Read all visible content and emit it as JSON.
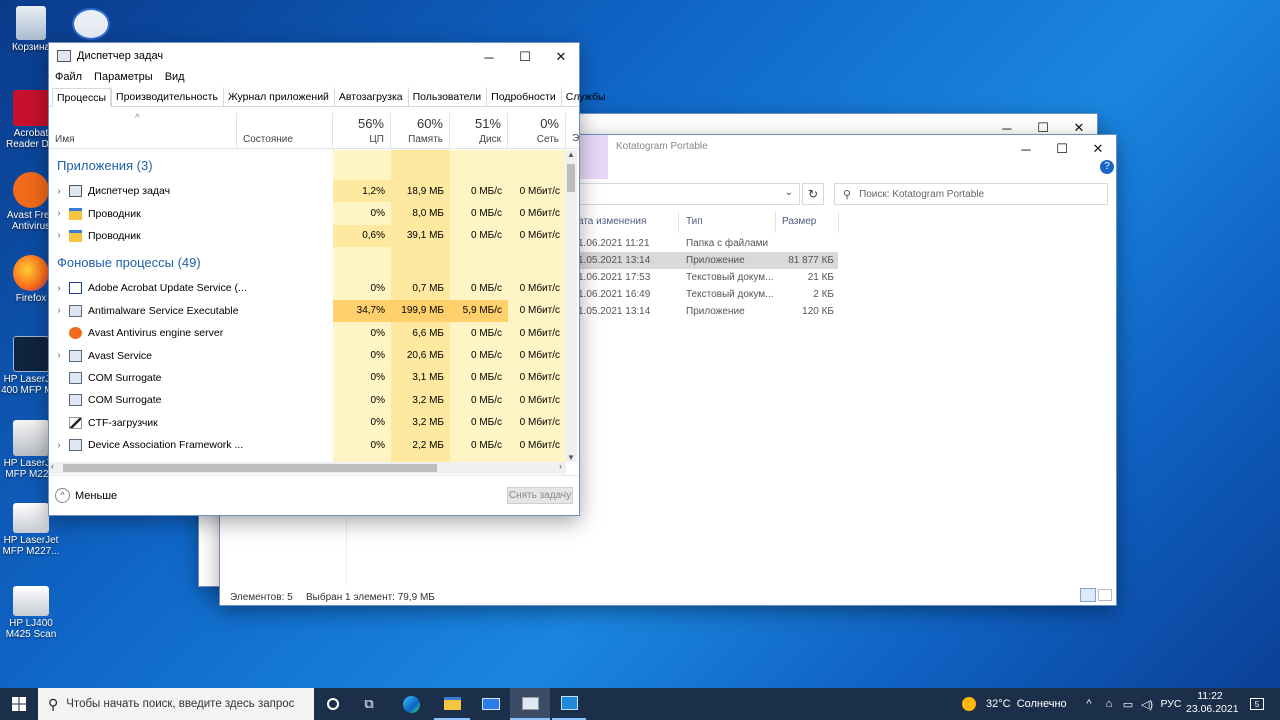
{
  "desktop": {
    "icons": [
      {
        "label": "Корзина"
      },
      {
        "label": "Acrobat\nReader DC"
      },
      {
        "label": "Avast Free\nAntivirus"
      },
      {
        "label": "Firefox"
      },
      {
        "label": "HP LaserJet\n400 MFP M..."
      },
      {
        "label": "HP LaserJet\nMFP M22..."
      },
      {
        "label": "HP LaserJet\nMFP M227..."
      },
      {
        "label": "HP LJ400\nM425 Scan"
      }
    ]
  },
  "task_manager": {
    "title": "Диспетчер задач",
    "menu": [
      "Файл",
      "Параметры",
      "Вид"
    ],
    "tabs": [
      "Процессы",
      "Производительность",
      "Журнал приложений",
      "Автозагрузка",
      "Пользователи",
      "Подробности",
      "Службы"
    ],
    "columns": {
      "name": "Имя",
      "status": "Состояние",
      "cpu_pct": "56%",
      "cpu": "ЦП",
      "mem_pct": "60%",
      "mem": "Память",
      "disk_pct": "51%",
      "disk": "Диск",
      "net_pct": "0%",
      "net": "Сеть",
      "extra": "Э"
    },
    "groups": [
      {
        "title": "Приложения (3)",
        "rows": [
          {
            "name": "Диспетчер задач",
            "cpu": "1,2%",
            "mem": "18,9 МБ",
            "disk": "0 МБ/с",
            "net": "0 Мбит/с",
            "expand": true
          },
          {
            "name": "Проводник",
            "cpu": "0%",
            "mem": "8,0 МБ",
            "disk": "0 МБ/с",
            "net": "0 Мбит/с",
            "expand": true
          },
          {
            "name": "Проводник",
            "cpu": "0,6%",
            "mem": "39,1 МБ",
            "disk": "0 МБ/с",
            "net": "0 Мбит/с",
            "expand": true
          }
        ]
      },
      {
        "title": "Фоновые процессы (49)",
        "rows": [
          {
            "name": "Adobe Acrobat Update Service (...",
            "cpu": "0%",
            "mem": "0,7 МБ",
            "disk": "0 МБ/с",
            "net": "0 Мбит/с",
            "expand": true
          },
          {
            "name": "Antimalware Service Executable",
            "cpu": "34,7%",
            "mem": "199,9 МБ",
            "disk": "5,9 МБ/с",
            "net": "0 Мбит/с",
            "expand": true
          },
          {
            "name": "Avast Antivirus engine server",
            "cpu": "0%",
            "mem": "6,6 МБ",
            "disk": "0 МБ/с",
            "net": "0 Мбит/с",
            "expand": false
          },
          {
            "name": "Avast Service",
            "cpu": "0%",
            "mem": "20,6 МБ",
            "disk": "0 МБ/с",
            "net": "0 Мбит/с",
            "expand": true
          },
          {
            "name": "COM Surrogate",
            "cpu": "0%",
            "mem": "3,1 МБ",
            "disk": "0 МБ/с",
            "net": "0 Мбит/с",
            "expand": false
          },
          {
            "name": "COM Surrogate",
            "cpu": "0%",
            "mem": "3,2 МБ",
            "disk": "0 МБ/с",
            "net": "0 Мбит/с",
            "expand": false
          },
          {
            "name": "CTF-загрузчик",
            "cpu": "0%",
            "mem": "3,2 МБ",
            "disk": "0 МБ/с",
            "net": "0 Мбит/с",
            "expand": false
          },
          {
            "name": "Device Association Framework ...",
            "cpu": "0%",
            "mem": "2,2 МБ",
            "disk": "0 МБ/с",
            "net": "0 Мбит/с",
            "expand": true
          }
        ]
      }
    ],
    "footer": {
      "less": "Меньше",
      "end_task": "Снять задачу"
    }
  },
  "explorer": {
    "title": "Kotatogram Portable",
    "search_placeholder": "Поиск: Kotatogram Portable",
    "columns": {
      "date": "ата изменения",
      "type": "Тип",
      "size": "Размер"
    },
    "rows": [
      {
        "date": "1.06.2021 11:21",
        "type": "Папка с файлами",
        "size": "",
        "selected": false
      },
      {
        "date": "1.05.2021 13:14",
        "type": "Приложение",
        "size": "81 877 КБ",
        "selected": true
      },
      {
        "date": "1.06.2021 17:53",
        "type": "Текстовый докум...",
        "size": "21 КБ",
        "selected": false
      },
      {
        "date": "1.06.2021 16:49",
        "type": "Текстовый докум...",
        "size": "2 КБ",
        "selected": false
      },
      {
        "date": "1.05.2021 13:14",
        "type": "Приложение",
        "size": "120 КБ",
        "selected": false
      }
    ],
    "status": {
      "items": "Элементов: 5",
      "selected": "Выбран 1 элемент: 79,9 МБ"
    }
  },
  "taskbar": {
    "search_placeholder": "Чтобы начать поиск, введите здесь запрос",
    "weather": "32°C  Солнечно",
    "lang": "РУС",
    "time": "11:22",
    "date": "23.06.2021",
    "notifications": "5"
  },
  "colors": {
    "accent": "#1f5fa8",
    "cpu_heat_low": "#fff4c4",
    "cpu_heat_mid": "#ffe9a0",
    "cpu_heat_high": "#ffd06b",
    "selected_row": "#d9d9d9",
    "taskbar": "#1c2f4a"
  }
}
